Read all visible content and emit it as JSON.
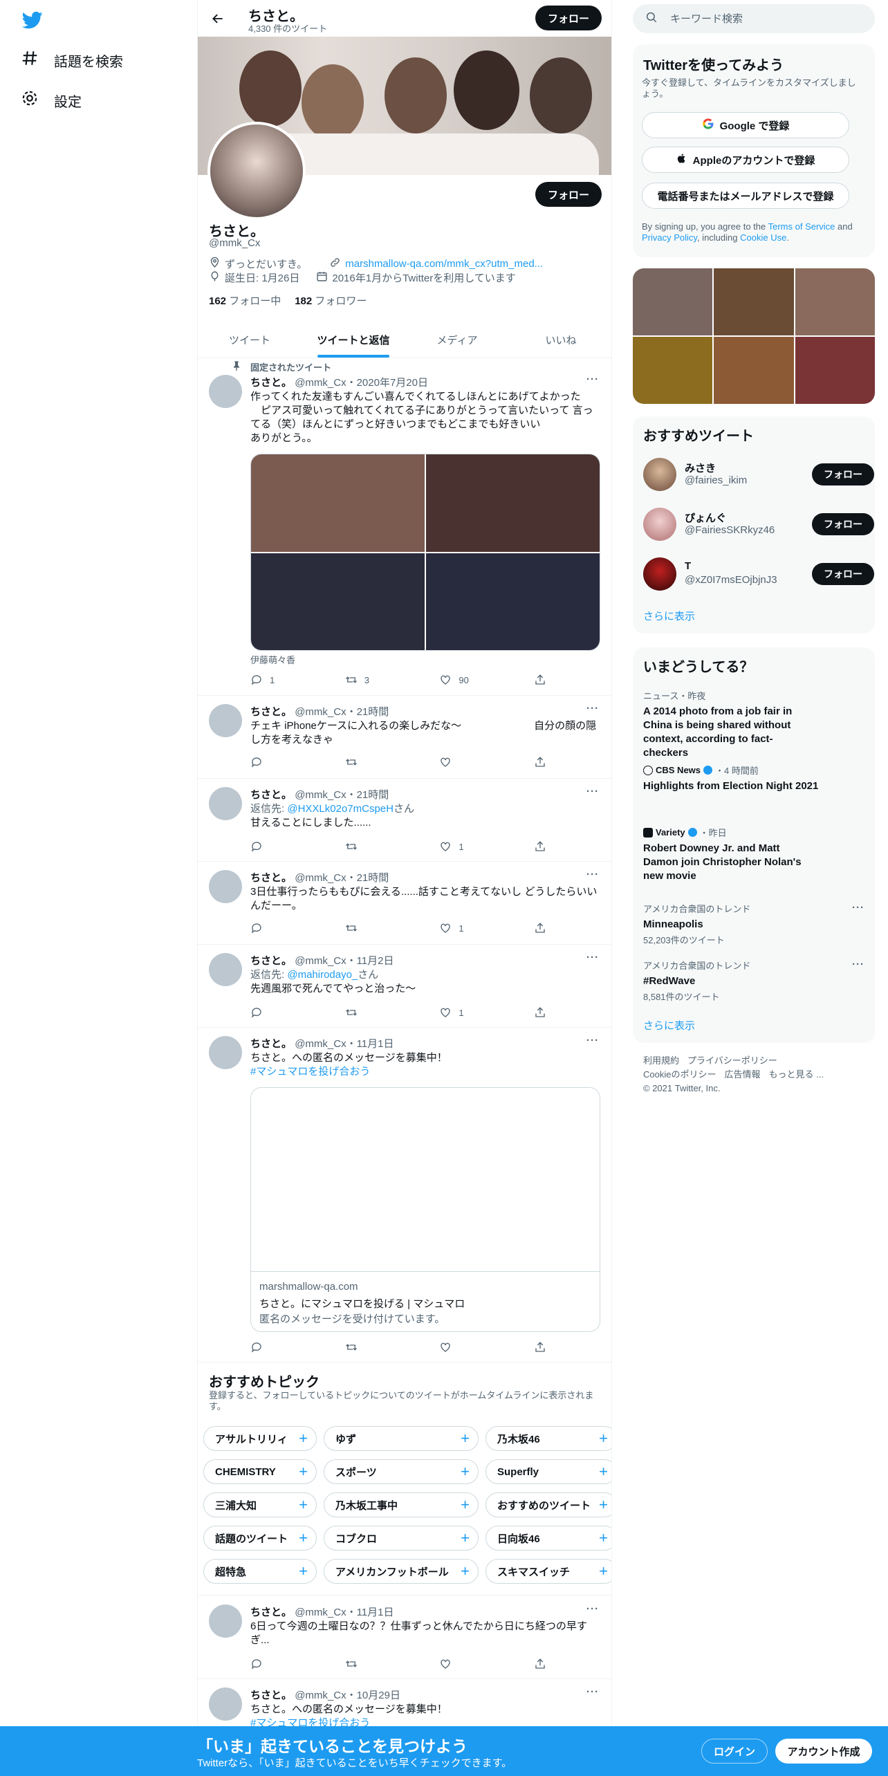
{
  "colors": {
    "accent": "#1d9bf0",
    "text": "#0f1419",
    "muted": "#536471",
    "border": "#eff3f4"
  },
  "nav": {
    "logo_icon": "twitter-bird-icon",
    "explore": "話題を検索",
    "settings": "設定"
  },
  "header": {
    "name": "ちさと。",
    "tweet_count": "4,330 件のツイート",
    "follow": "フォロー"
  },
  "profile": {
    "name": "ちさと。",
    "handle": "@mmk_Cx",
    "bio": "ずっとだいすき。",
    "link": "marshmallow-qa.com/mmk_cx?utm_med...",
    "birthday": "誕生日: 1月26日",
    "joined": "2016年1月からTwitterを利用しています",
    "following_count": "162",
    "following_label": "フォロー中",
    "followers_count": "182",
    "followers_label": "フォロワー",
    "follow": "フォロー"
  },
  "tabs": [
    "ツイート",
    "ツイートと返信",
    "メディア",
    "いいね"
  ],
  "pinned_label": "固定されたツイート",
  "tweets": [
    {
      "name": "ちさと。",
      "meta": "@mmk_Cx・2020年7月20日",
      "text": "作ってくれた友達もすんごい喜んでくれてるしほんとにあげてよかった\n　ピアス可愛いって触れてくれてる子にありがとうって言いたいって 言ってる（笑）ほんとにずっと好きいつまでもどこまでも好きいい\nありがとう。。",
      "caption": "伊藤萌々香",
      "reply": "1",
      "retweet": "3",
      "like": "90"
    },
    {
      "name": "ちさと。",
      "meta": "@mmk_Cx・21時間",
      "text": "チェキ iPhoneケースに入れるの楽しみだな〜　　　　　　　自分の顔の隠し方を考えなきゃ",
      "reply": "",
      "retweet": "",
      "like": ""
    },
    {
      "name": "ちさと。",
      "meta": "@mmk_Cx・21時間",
      "reply_to_label": "返信先: ",
      "reply_to_user": "@HXXLk02o7mCspeH",
      "reply_to_suffix": "さん",
      "text": "甘えることにしました......",
      "reply": "",
      "retweet": "",
      "like": "1"
    },
    {
      "name": "ちさと。",
      "meta": "@mmk_Cx・21時間",
      "text": "3日仕事行ったらももぴに会える......話すこと考えてないし どうしたらいいんだーー。",
      "reply": "",
      "retweet": "",
      "like": "1"
    },
    {
      "name": "ちさと。",
      "meta": "@mmk_Cx・11月2日",
      "reply_to_label": "返信先: ",
      "reply_to_user": "@mahirodayo_",
      "reply_to_suffix": "さん",
      "text": "先週風邪で死んでてやっと治った〜",
      "reply": "",
      "retweet": "",
      "like": "1"
    },
    {
      "name": "ちさと。",
      "meta": "@mmk_Cx・11月1日",
      "text": "ちさと。への匿名のメッセージを募集中！",
      "hashtag": "#マシュマロを投げ合おう",
      "card_domain": "marshmallow-qa.com",
      "card_title": "ちさと。にマシュマロを投げる | マシュマロ",
      "card_desc": "匿名のメッセージを受け付けています。"
    },
    {
      "name": "ちさと。",
      "meta": "@mmk_Cx・11月1日",
      "text": "6日って今週の土曜日なの？？仕事ずっと休んでたから日にち経つの早すぎ..."
    },
    {
      "name": "ちさと。",
      "meta": "@mmk_Cx・10月29日",
      "text": "ちさと。への匿名のメッセージを募集中！",
      "hashtag": "#マシュマロを投げ合おう"
    }
  ],
  "topics": {
    "title": "おすすめトピック",
    "subtitle": "登録すると、フォローしているトピックについてのツイートがホームタイムラインに表示されます。",
    "chips": [
      "アサルトリリィ",
      "ゆず",
      "乃木坂46",
      "CHEMISTRY",
      "スポーツ",
      "Superfly",
      "三浦大知",
      "乃木坂工事中",
      "おすすめのツイート",
      "話題のツイート",
      "コブクロ",
      "日向坂46",
      "超特急",
      "アメリカンフットボール",
      "スキマスイッチ"
    ]
  },
  "search": {
    "placeholder": "キーワード検索"
  },
  "signup_panel": {
    "title": "Twitterを使ってみよう",
    "subtitle": "今すぐ登録して、タイムラインをカスタマイズしましょう。",
    "google": "Google で登録",
    "apple": "Appleのアカウントで登録",
    "phone": "電話番号またはメールアドレスで登録",
    "legal_1": "By signing up, you agree to the ",
    "terms": "Terms of Service",
    "legal_2": " and ",
    "privacy": "Privacy Policy",
    "legal_3": ", including ",
    "cookie": "Cookie Use",
    "legal_4": "."
  },
  "who_to_follow": {
    "title": "おすすめツイート",
    "users": [
      {
        "name": "みさき",
        "handle": "@fairies_ikim",
        "follow": "フォロー"
      },
      {
        "name": "ぴょんぐ",
        "handle": "@FairiesSKRkyz46",
        "follow": "フォロー"
      },
      {
        "name": "T",
        "handle": "@xZ0I7msEOjbjnJ3",
        "follow": "フォロー"
      }
    ],
    "more": "さらに表示"
  },
  "trends": {
    "title": "いまどうしてる？",
    "items": [
      {
        "meta": "ニュース・昨夜",
        "title": "A 2014 photo from a job fair in China is being shared without context, according to fact-checkers"
      },
      {
        "source": "CBS News",
        "time": "・4 時間前",
        "title": "Highlights from Election Night 2021"
      },
      {
        "source": "Variety",
        "time": "・昨日",
        "title": "Robert Downey Jr. and Matt Damon join Christopher Nolan's new movie"
      },
      {
        "meta": "アメリカ合衆国のトレンド",
        "title": "Minneapolis",
        "count": "52,203件のツイート"
      },
      {
        "meta": "アメリカ合衆国のトレンド",
        "title": "#RedWave",
        "count": "8,581件のツイート"
      }
    ],
    "more": "さらに表示"
  },
  "footer": {
    "terms": "利用規約",
    "privacy": "プライバシーポリシー",
    "cookie": "Cookieのポリシー",
    "ads": "広告情報",
    "more": "もっと見る ...",
    "copyright": "© 2021 Twitter, Inc."
  },
  "bottom_bar": {
    "title": "「いま」起きていることを見つけよう",
    "subtitle": "Twitterなら、「いま」起きていることをいち早くチェックできます。",
    "login": "ログイン",
    "signup": "アカウント作成"
  }
}
